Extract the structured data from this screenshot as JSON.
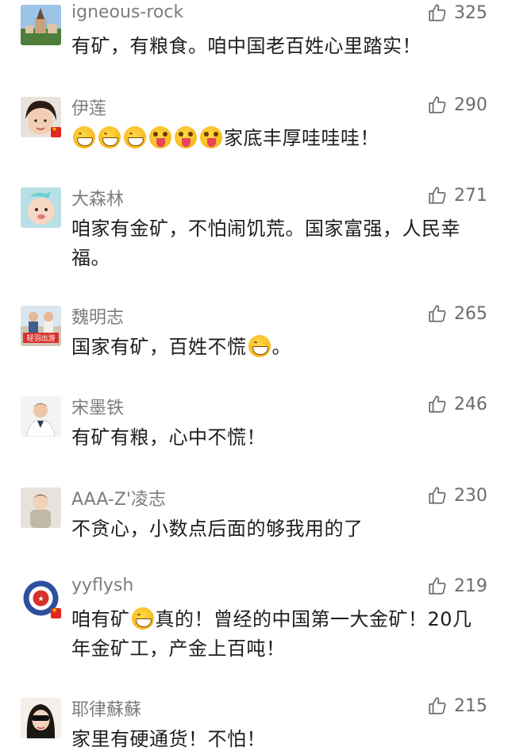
{
  "comments": [
    {
      "name": "igneous-rock",
      "likes": "325",
      "text": "有矿，有粮食。咱中国老百姓心里踏实！"
    },
    {
      "name": "伊莲",
      "likes": "290",
      "text_suffix": "家底丰厚哇哇哇！"
    },
    {
      "name": "大森林",
      "likes": "271",
      "text": "咱家有金矿，不怕闹饥荒。国家富强，人民幸福。"
    },
    {
      "name": "魏明志",
      "likes": "265",
      "text_prefix": "国家有矿，百姓不慌",
      "text_suffix": "。",
      "avatar_caption": "轻羽出游"
    },
    {
      "name": "宋墨铁",
      "likes": "246",
      "text": "有矿有粮，心中不慌！"
    },
    {
      "name": "AAA-Z'凌志",
      "likes": "230",
      "text": "不贪心，小数点后面的够我用的了"
    },
    {
      "name": "yyflysh",
      "likes": "219",
      "text_prefix": "咱有矿",
      "text_suffix": "真的！曾经的中国第一大金矿！20几年金矿工，产金上百吨！"
    },
    {
      "name": "耶律蘇蘇",
      "likes": "215",
      "text": "家里有硬通货！不怕！"
    }
  ],
  "icons": {
    "like": "thumbs-up-outline-icon",
    "grin": "grinning-emoji",
    "tongue": "tongue-out-emoji"
  },
  "colors": {
    "name": "#7d7d7d",
    "text": "#1e1e1e",
    "likes": "#6c6c6c"
  }
}
